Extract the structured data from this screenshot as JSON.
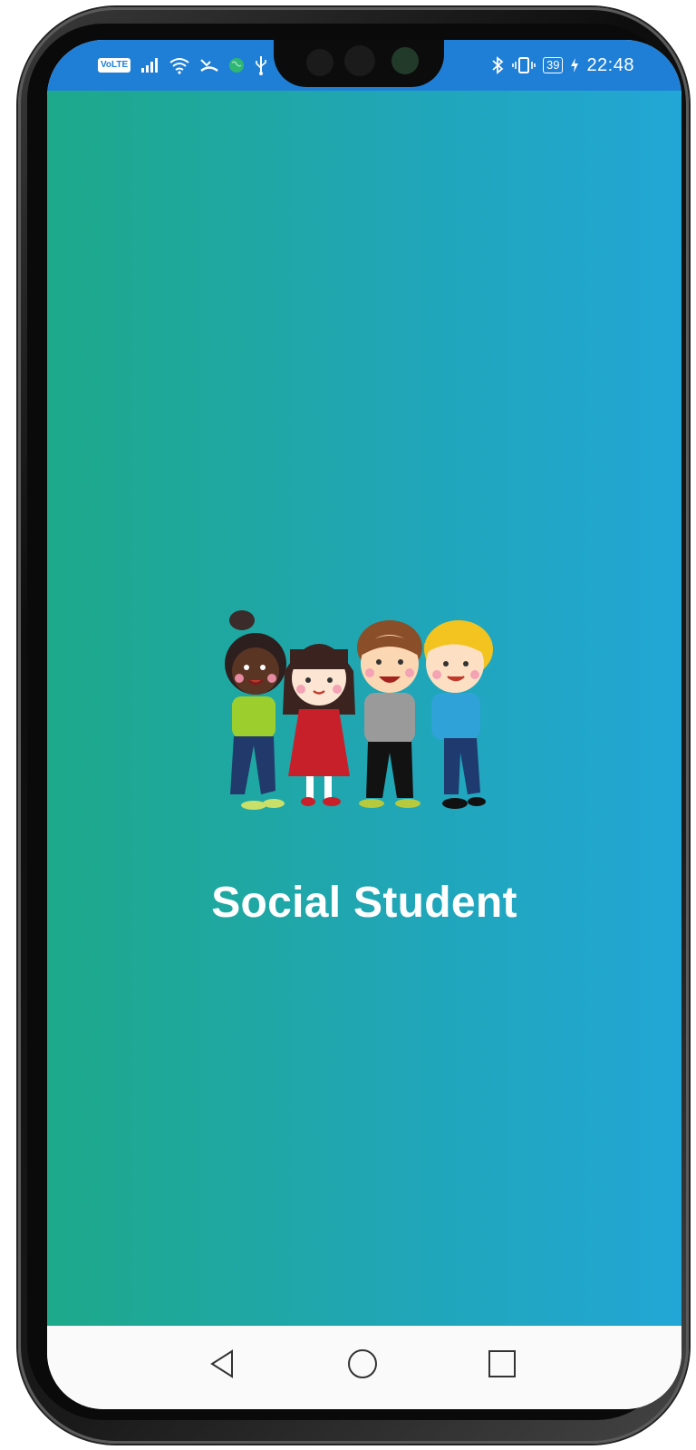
{
  "status_bar": {
    "volte": "VoLTE",
    "battery": "39",
    "time": "22:48",
    "background": "#1f7fd6"
  },
  "app": {
    "title": "Social Student",
    "gradient_start": "#1da98a",
    "gradient_end": "#22a6d6"
  },
  "icons": {
    "signal": "signal-icon",
    "wifi": "wifi-icon",
    "missed_call": "missed-call-icon",
    "vpn": "vpn-globe-icon",
    "usb": "usb-icon",
    "bluetooth": "bluetooth-icon",
    "vibrate": "vibrate-icon",
    "charging": "charging-icon",
    "back": "back-triangle-icon",
    "home": "home-circle-icon",
    "recents": "recents-square-icon"
  }
}
